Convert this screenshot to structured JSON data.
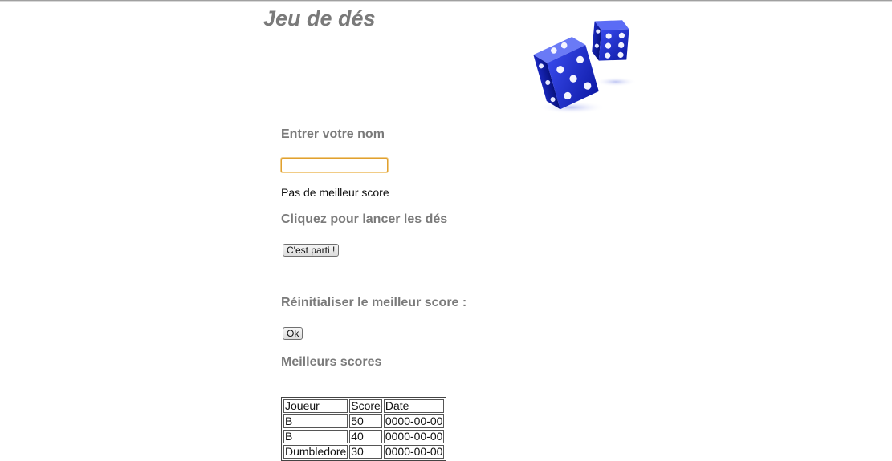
{
  "header": {
    "title": "Jeu de dés",
    "logo_icon": "dice-icon"
  },
  "name_section": {
    "heading": "Entrer votre nom",
    "input_value": "",
    "status": "Pas de meilleur score"
  },
  "roll_section": {
    "heading": "Cliquez pour lancer les dés",
    "button_label": "C'est parti !"
  },
  "reset_section": {
    "heading": "Réinitialiser le meilleur score :",
    "button_label": "Ok"
  },
  "scores": {
    "heading": "Meilleurs scores",
    "columns": [
      "Joueur",
      "Score",
      "Date"
    ],
    "rows": [
      [
        "B",
        "50",
        "0000-00-00"
      ],
      [
        "B",
        "40",
        "0000-00-00"
      ],
      [
        "Dumbledore",
        "30",
        "0000-00-00"
      ]
    ]
  },
  "colors": {
    "heading": "#7a7a7a",
    "dice_blue": "#1e2fd0",
    "input_focus": "#e0a030"
  }
}
